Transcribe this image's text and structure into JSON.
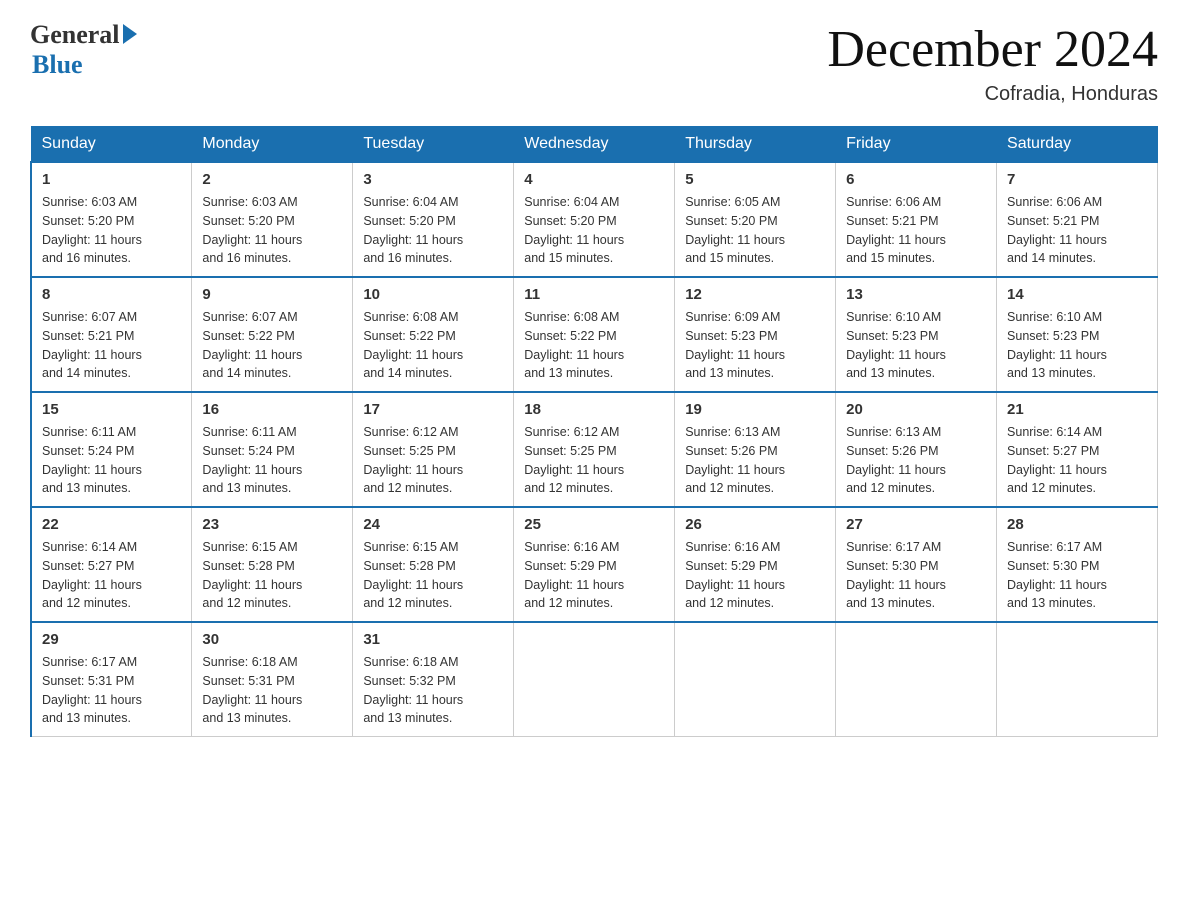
{
  "header": {
    "logo": {
      "general": "General",
      "blue": "Blue"
    },
    "title": "December 2024",
    "location": "Cofradia, Honduras"
  },
  "days_of_week": [
    "Sunday",
    "Monday",
    "Tuesday",
    "Wednesday",
    "Thursday",
    "Friday",
    "Saturday"
  ],
  "weeks": [
    [
      {
        "day": "1",
        "sunrise": "6:03 AM",
        "sunset": "5:20 PM",
        "daylight": "11 hours and 16 minutes."
      },
      {
        "day": "2",
        "sunrise": "6:03 AM",
        "sunset": "5:20 PM",
        "daylight": "11 hours and 16 minutes."
      },
      {
        "day": "3",
        "sunrise": "6:04 AM",
        "sunset": "5:20 PM",
        "daylight": "11 hours and 16 minutes."
      },
      {
        "day": "4",
        "sunrise": "6:04 AM",
        "sunset": "5:20 PM",
        "daylight": "11 hours and 15 minutes."
      },
      {
        "day": "5",
        "sunrise": "6:05 AM",
        "sunset": "5:20 PM",
        "daylight": "11 hours and 15 minutes."
      },
      {
        "day": "6",
        "sunrise": "6:06 AM",
        "sunset": "5:21 PM",
        "daylight": "11 hours and 15 minutes."
      },
      {
        "day": "7",
        "sunrise": "6:06 AM",
        "sunset": "5:21 PM",
        "daylight": "11 hours and 14 minutes."
      }
    ],
    [
      {
        "day": "8",
        "sunrise": "6:07 AM",
        "sunset": "5:21 PM",
        "daylight": "11 hours and 14 minutes."
      },
      {
        "day": "9",
        "sunrise": "6:07 AM",
        "sunset": "5:22 PM",
        "daylight": "11 hours and 14 minutes."
      },
      {
        "day": "10",
        "sunrise": "6:08 AM",
        "sunset": "5:22 PM",
        "daylight": "11 hours and 14 minutes."
      },
      {
        "day": "11",
        "sunrise": "6:08 AM",
        "sunset": "5:22 PM",
        "daylight": "11 hours and 13 minutes."
      },
      {
        "day": "12",
        "sunrise": "6:09 AM",
        "sunset": "5:23 PM",
        "daylight": "11 hours and 13 minutes."
      },
      {
        "day": "13",
        "sunrise": "6:10 AM",
        "sunset": "5:23 PM",
        "daylight": "11 hours and 13 minutes."
      },
      {
        "day": "14",
        "sunrise": "6:10 AM",
        "sunset": "5:23 PM",
        "daylight": "11 hours and 13 minutes."
      }
    ],
    [
      {
        "day": "15",
        "sunrise": "6:11 AM",
        "sunset": "5:24 PM",
        "daylight": "11 hours and 13 minutes."
      },
      {
        "day": "16",
        "sunrise": "6:11 AM",
        "sunset": "5:24 PM",
        "daylight": "11 hours and 13 minutes."
      },
      {
        "day": "17",
        "sunrise": "6:12 AM",
        "sunset": "5:25 PM",
        "daylight": "11 hours and 12 minutes."
      },
      {
        "day": "18",
        "sunrise": "6:12 AM",
        "sunset": "5:25 PM",
        "daylight": "11 hours and 12 minutes."
      },
      {
        "day": "19",
        "sunrise": "6:13 AM",
        "sunset": "5:26 PM",
        "daylight": "11 hours and 12 minutes."
      },
      {
        "day": "20",
        "sunrise": "6:13 AM",
        "sunset": "5:26 PM",
        "daylight": "11 hours and 12 minutes."
      },
      {
        "day": "21",
        "sunrise": "6:14 AM",
        "sunset": "5:27 PM",
        "daylight": "11 hours and 12 minutes."
      }
    ],
    [
      {
        "day": "22",
        "sunrise": "6:14 AM",
        "sunset": "5:27 PM",
        "daylight": "11 hours and 12 minutes."
      },
      {
        "day": "23",
        "sunrise": "6:15 AM",
        "sunset": "5:28 PM",
        "daylight": "11 hours and 12 minutes."
      },
      {
        "day": "24",
        "sunrise": "6:15 AM",
        "sunset": "5:28 PM",
        "daylight": "11 hours and 12 minutes."
      },
      {
        "day": "25",
        "sunrise": "6:16 AM",
        "sunset": "5:29 PM",
        "daylight": "11 hours and 12 minutes."
      },
      {
        "day": "26",
        "sunrise": "6:16 AM",
        "sunset": "5:29 PM",
        "daylight": "11 hours and 12 minutes."
      },
      {
        "day": "27",
        "sunrise": "6:17 AM",
        "sunset": "5:30 PM",
        "daylight": "11 hours and 13 minutes."
      },
      {
        "day": "28",
        "sunrise": "6:17 AM",
        "sunset": "5:30 PM",
        "daylight": "11 hours and 13 minutes."
      }
    ],
    [
      {
        "day": "29",
        "sunrise": "6:17 AM",
        "sunset": "5:31 PM",
        "daylight": "11 hours and 13 minutes."
      },
      {
        "day": "30",
        "sunrise": "6:18 AM",
        "sunset": "5:31 PM",
        "daylight": "11 hours and 13 minutes."
      },
      {
        "day": "31",
        "sunrise": "6:18 AM",
        "sunset": "5:32 PM",
        "daylight": "11 hours and 13 minutes."
      },
      null,
      null,
      null,
      null
    ]
  ],
  "labels": {
    "sunrise": "Sunrise:",
    "sunset": "Sunset:",
    "daylight": "Daylight:"
  }
}
